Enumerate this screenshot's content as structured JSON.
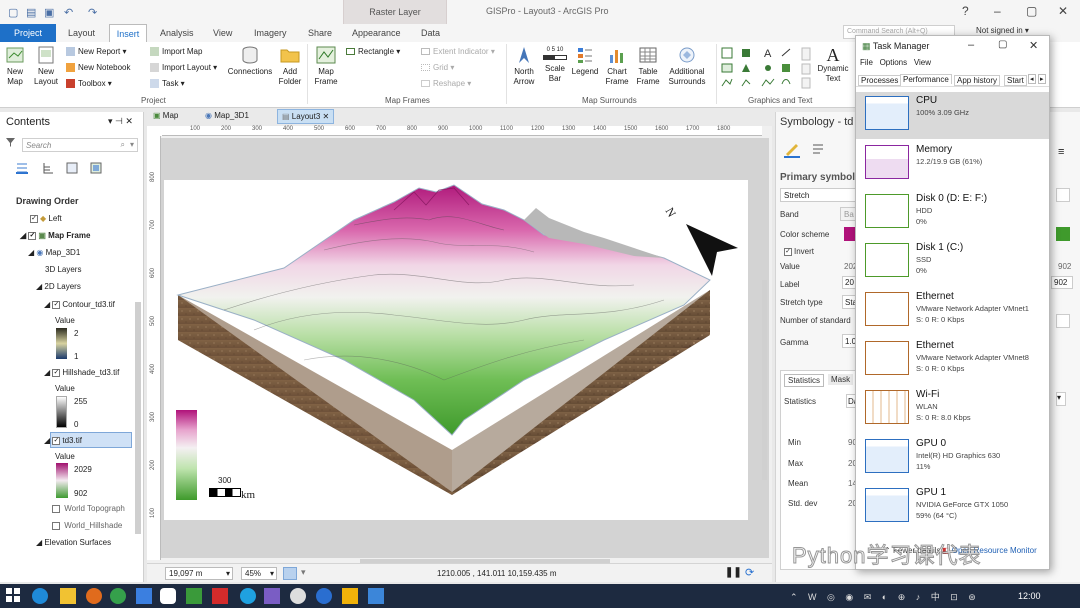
{
  "app": {
    "title": "GISPro - Layout3 - ArcGIS Pro",
    "context_tab": "Raster Layer",
    "search_placeholder": "Command Search (Alt+Q)",
    "signin": "Not signed in",
    "help": "?"
  },
  "tabs": [
    "Project",
    "Layout",
    "Insert",
    "Analysis",
    "View",
    "Imagery",
    "Share",
    "Appearance",
    "Data"
  ],
  "ribbon": {
    "project_group": {
      "new_map": "New\nMap",
      "new_layout": "New\nLayout",
      "new_report": "New Report",
      "new_notebook": "New Notebook",
      "toolbox": "Toolbox",
      "import_map": "Import Map",
      "import_layout": "Import Layout",
      "task": "Task",
      "connections": "Connections",
      "add_folder": "Add\nFolder",
      "label": "Project"
    },
    "map_frames_group": {
      "map_frame": "Map\nFrame",
      "rectangle": "Rectangle",
      "extent_indicator": "Extent Indicator",
      "grid": "Grid",
      "reshape": "Reshape",
      "label": "Map Frames"
    },
    "map_surrounds_group": {
      "north_arrow": "North\nArrow",
      "scale_bar": "Scale\nBar",
      "legend": "Legend",
      "chart_frame": "Chart\nFrame",
      "table_frame": "Table\nFrame",
      "additional_surrounds": "Additional\nSurrounds",
      "scale_ticks": "0  5  10",
      "label": "Map Surrounds"
    },
    "graphics_group": {
      "dynamic_text": "Dynamic\nText",
      "label": "Graphics and Text"
    }
  },
  "contents": {
    "title": "Contents",
    "search_placeholder": "Search",
    "drawing_order": "Drawing Order",
    "items": {
      "left": "Left",
      "map_frame": "Map Frame",
      "map_3d1": "Map_3D1",
      "layers_3d": "3D Layers",
      "layers_2d": "2D Layers",
      "contour": "Contour_td3.tif",
      "contour_value": "Value",
      "contour_max": "2",
      "contour_min": "1",
      "hillshade": "Hillshade_td3.tif",
      "hillshade_value": "Value",
      "hillshade_max": "255",
      "hillshade_min": "0",
      "td3": "td3.tif",
      "td3_value": "Value",
      "td3_max": "2029",
      "td3_min": "902",
      "world_topo": "World Topograph",
      "world_hillshade": "World_Hillshade",
      "elevation": "Elevation Surfaces"
    }
  },
  "view_tabs": [
    "Map",
    "Map_3D1",
    "Layout3"
  ],
  "layout": {
    "scalebar_label": "300",
    "scalebar_unit": "km",
    "north_letter": "N"
  },
  "ruler_top": [
    "100",
    "200",
    "300",
    "400",
    "500",
    "600",
    "700",
    "800",
    "900",
    "1000",
    "1100",
    "1200",
    "1300",
    "1400",
    "1500",
    "1600",
    "1700",
    "1800"
  ],
  "ruler_left": [
    "800",
    "700",
    "600",
    "500",
    "400",
    "300",
    "200",
    "100"
  ],
  "status": {
    "scale": "19,097 m",
    "zoom": "45%",
    "coords": "1210.005 , 141.011  10,159.435 m"
  },
  "symbology": {
    "title": "Symbology - td",
    "primary": "Primary symbolo",
    "stretch": "Stretch",
    "band": "Band",
    "band_val": "Ba",
    "color_scheme": "Color scheme",
    "invert": "Invert",
    "value": "Value",
    "value_a": "202",
    "value_b": "902",
    "label": "Label",
    "label_a": "20",
    "label_b": "902",
    "stretch_type": "Stretch type",
    "stretch_type_val": "Sta",
    "num_std": "Number of standard",
    "gamma": "Gamma",
    "gamma_val": "1.0",
    "tab_statistics": "Statistics",
    "tab_mask": "Mask",
    "statistics": "Statistics",
    "statistics_val": "Da",
    "min": "Min",
    "min_val": "90",
    "max": "Max",
    "max_val": "20",
    "mean": "Mean",
    "mean_val": "14",
    "std": "Std. dev",
    "std_val": "20"
  },
  "task_manager": {
    "title": "Task Manager",
    "menu": [
      "File",
      "Options",
      "View"
    ],
    "tabs": [
      "Processes",
      "Performance",
      "App history",
      "Start"
    ],
    "items": [
      {
        "name": "CPU",
        "line1": "100%  3.09 GHz",
        "line2": ""
      },
      {
        "name": "Memory",
        "line1": "12.2/19.9 GB (61%)",
        "line2": ""
      },
      {
        "name": "Disk 0 (D: E: F:)",
        "line1": "HDD",
        "line2": "0%"
      },
      {
        "name": "Disk 1 (C:)",
        "line1": "SSD",
        "line2": "0%"
      },
      {
        "name": "Ethernet",
        "line1": "VMware Network Adapter VMnet1",
        "line2": "S: 0  R: 0 Kbps"
      },
      {
        "name": "Ethernet",
        "line1": "VMware Network Adapter VMnet8",
        "line2": "S: 0  R: 0 Kbps"
      },
      {
        "name": "Wi-Fi",
        "line1": "WLAN",
        "line2": "S: 0  R: 8.0 Kbps"
      },
      {
        "name": "GPU 0",
        "line1": "Intel(R) HD Graphics 630",
        "line2": "11%"
      },
      {
        "name": "GPU 1",
        "line1": "NVIDIA GeForce GTX 1050",
        "line2": "59%  (64 °C)"
      }
    ],
    "fewer_details": "Fewer details",
    "open_monitor": "Open Resource Monitor"
  },
  "taskbar": {
    "time": "12:00"
  },
  "watermark": "Python学习课代表"
}
